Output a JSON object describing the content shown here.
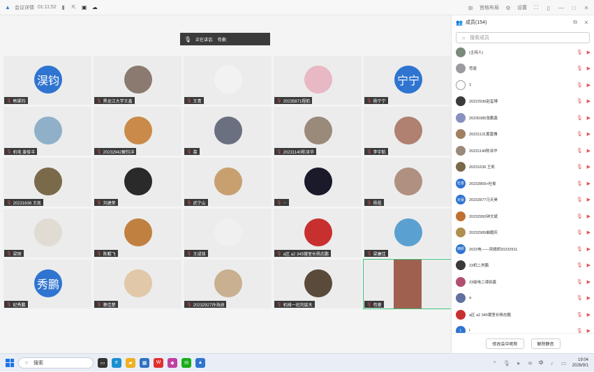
{
  "titlebar": {
    "meeting_info": "会议详情",
    "timer": "01:11:52",
    "layout_label": "宫格布局",
    "settings_label": "设置"
  },
  "stage": {
    "speaker_label": "正在讲话:",
    "speaker_name": "苟豪;"
  },
  "tiles": [
    {
      "name": "韩渠钧",
      "avatar_text": "淏钧",
      "type": "text"
    },
    {
      "name": "黑龙江大学王鑫",
      "avatar_text": "",
      "type": "photo",
      "color": "#8a7a70"
    },
    {
      "name": "王青",
      "avatar_text": "",
      "type": "photo",
      "color": "#f2f2f2"
    },
    {
      "name": "20235871程航",
      "avatar_text": "",
      "type": "photo",
      "color": "#e8b8c4"
    },
    {
      "name": "杨宁宁",
      "avatar_text": "宁宁",
      "type": "text"
    },
    {
      "name": "机电 姜俊羊",
      "avatar_text": "",
      "type": "photo",
      "color": "#8fb0c8"
    },
    {
      "name": "20232942解钧沣",
      "avatar_text": "",
      "type": "photo",
      "color": "#c98a4a"
    },
    {
      "name": "慕",
      "avatar_text": "",
      "type": "photo",
      "color": "#6a7080"
    },
    {
      "name": "20231140陈泽华",
      "avatar_text": "",
      "type": "photo",
      "color": "#9a8a7a"
    },
    {
      "name": "李宇航",
      "avatar_text": "",
      "type": "photo",
      "color": "#b08070"
    },
    {
      "name": "20231636 王凯",
      "avatar_text": "",
      "type": "photo",
      "color": "#7a6a4a"
    },
    {
      "name": "刘建荣",
      "avatar_text": "",
      "type": "photo",
      "color": "#2a2a2a"
    },
    {
      "name": "武宁山",
      "avatar_text": "",
      "type": "photo",
      "color": "#c8a070"
    },
    {
      "name": "...",
      "avatar_text": "",
      "type": "photo",
      "color": "#1a1a2a"
    },
    {
      "name": "杨祖",
      "avatar_text": "",
      "type": "photo",
      "color": "#b09080"
    },
    {
      "name": "梁琛",
      "avatar_text": "",
      "type": "photo",
      "color": "#e0dcd4"
    },
    {
      "name": "陈鲲飞",
      "avatar_text": "",
      "type": "photo",
      "color": "#c08040"
    },
    {
      "name": "王成铭",
      "avatar_text": "",
      "type": "photo",
      "color": "#f0f0f0"
    },
    {
      "name": "a区 a2 345寝室长杨志鹏",
      "avatar_text": "",
      "type": "photo",
      "color": "#c83030"
    },
    {
      "name": "梁康佳",
      "avatar_text": "",
      "type": "photo",
      "color": "#5aa0d0"
    },
    {
      "name": "纪秀鹏",
      "avatar_text": "秀鹏",
      "type": "text"
    },
    {
      "name": "蔡佳楚",
      "avatar_text": "",
      "type": "photo",
      "color": "#e0c8a8"
    },
    {
      "name": "20232927孙海迪",
      "avatar_text": "",
      "type": "photo",
      "color": "#c8b090"
    },
    {
      "name": "机械一班刘宸天",
      "avatar_text": "",
      "type": "photo",
      "color": "#5a4a3a"
    },
    {
      "name": "苟豪",
      "avatar_text": "",
      "type": "video",
      "color": "#a06050",
      "active": true
    }
  ],
  "sidebar": {
    "title": "成员(154)",
    "search_placeholder": "搜索成员",
    "members": [
      {
        "name": "(主持人)",
        "avatar_text": "",
        "color": "#7a8a7a"
      },
      {
        "name": "苟豪",
        "avatar_text": "",
        "color": "#9a9aa0"
      },
      {
        "name": "1",
        "avatar_text": "",
        "color": "#ffffff"
      },
      {
        "name": "20222936赵玺博",
        "avatar_text": "",
        "color": "#3a3a3a"
      },
      {
        "name": "20230385张鹏鑫",
        "avatar_text": "",
        "color": "#8890c0"
      },
      {
        "name": "20231131黄晋雅",
        "avatar_text": "",
        "color": "#a08060"
      },
      {
        "name": "20231140陈泽华",
        "avatar_text": "",
        "color": "#9a8a7a"
      },
      {
        "name": "20231636  王凯",
        "avatar_text": "",
        "color": "#7a6a4a"
      },
      {
        "name": "20232869+杜俊",
        "avatar_text": "杜俊",
        "color": "#2f74d0"
      },
      {
        "name": "20232877马天昊",
        "avatar_text": "天昊",
        "color": "#2f74d0"
      },
      {
        "name": "20232950钟文斌",
        "avatar_text": "",
        "color": "#c07030"
      },
      {
        "name": "20232989曲翰庆",
        "avatar_text": "",
        "color": "#b09050"
      },
      {
        "name": "2023电——宋婧妍20232911",
        "avatar_text": "婧妍",
        "color": "#2f74d0"
      },
      {
        "name": "23机二肖鹏",
        "avatar_text": "",
        "color": "#3a3a3a"
      },
      {
        "name": "23级电二谭劲鑫",
        "avatar_text": "",
        "color": "#b05070"
      },
      {
        "name": "a",
        "avatar_text": "",
        "color": "#6070a0"
      },
      {
        "name": "a区 a2 345寝室长杨志鹏",
        "avatar_text": "",
        "color": "#c83030"
      },
      {
        "name": "l",
        "avatar_text": "L",
        "color": "#2f74d0"
      }
    ],
    "footer_buttons": [
      "修改会中昵称",
      "解除静音"
    ]
  },
  "taskbar": {
    "search_label": "搜索",
    "time": "19:04",
    "date": "2026/9/1",
    "lang": "中"
  }
}
